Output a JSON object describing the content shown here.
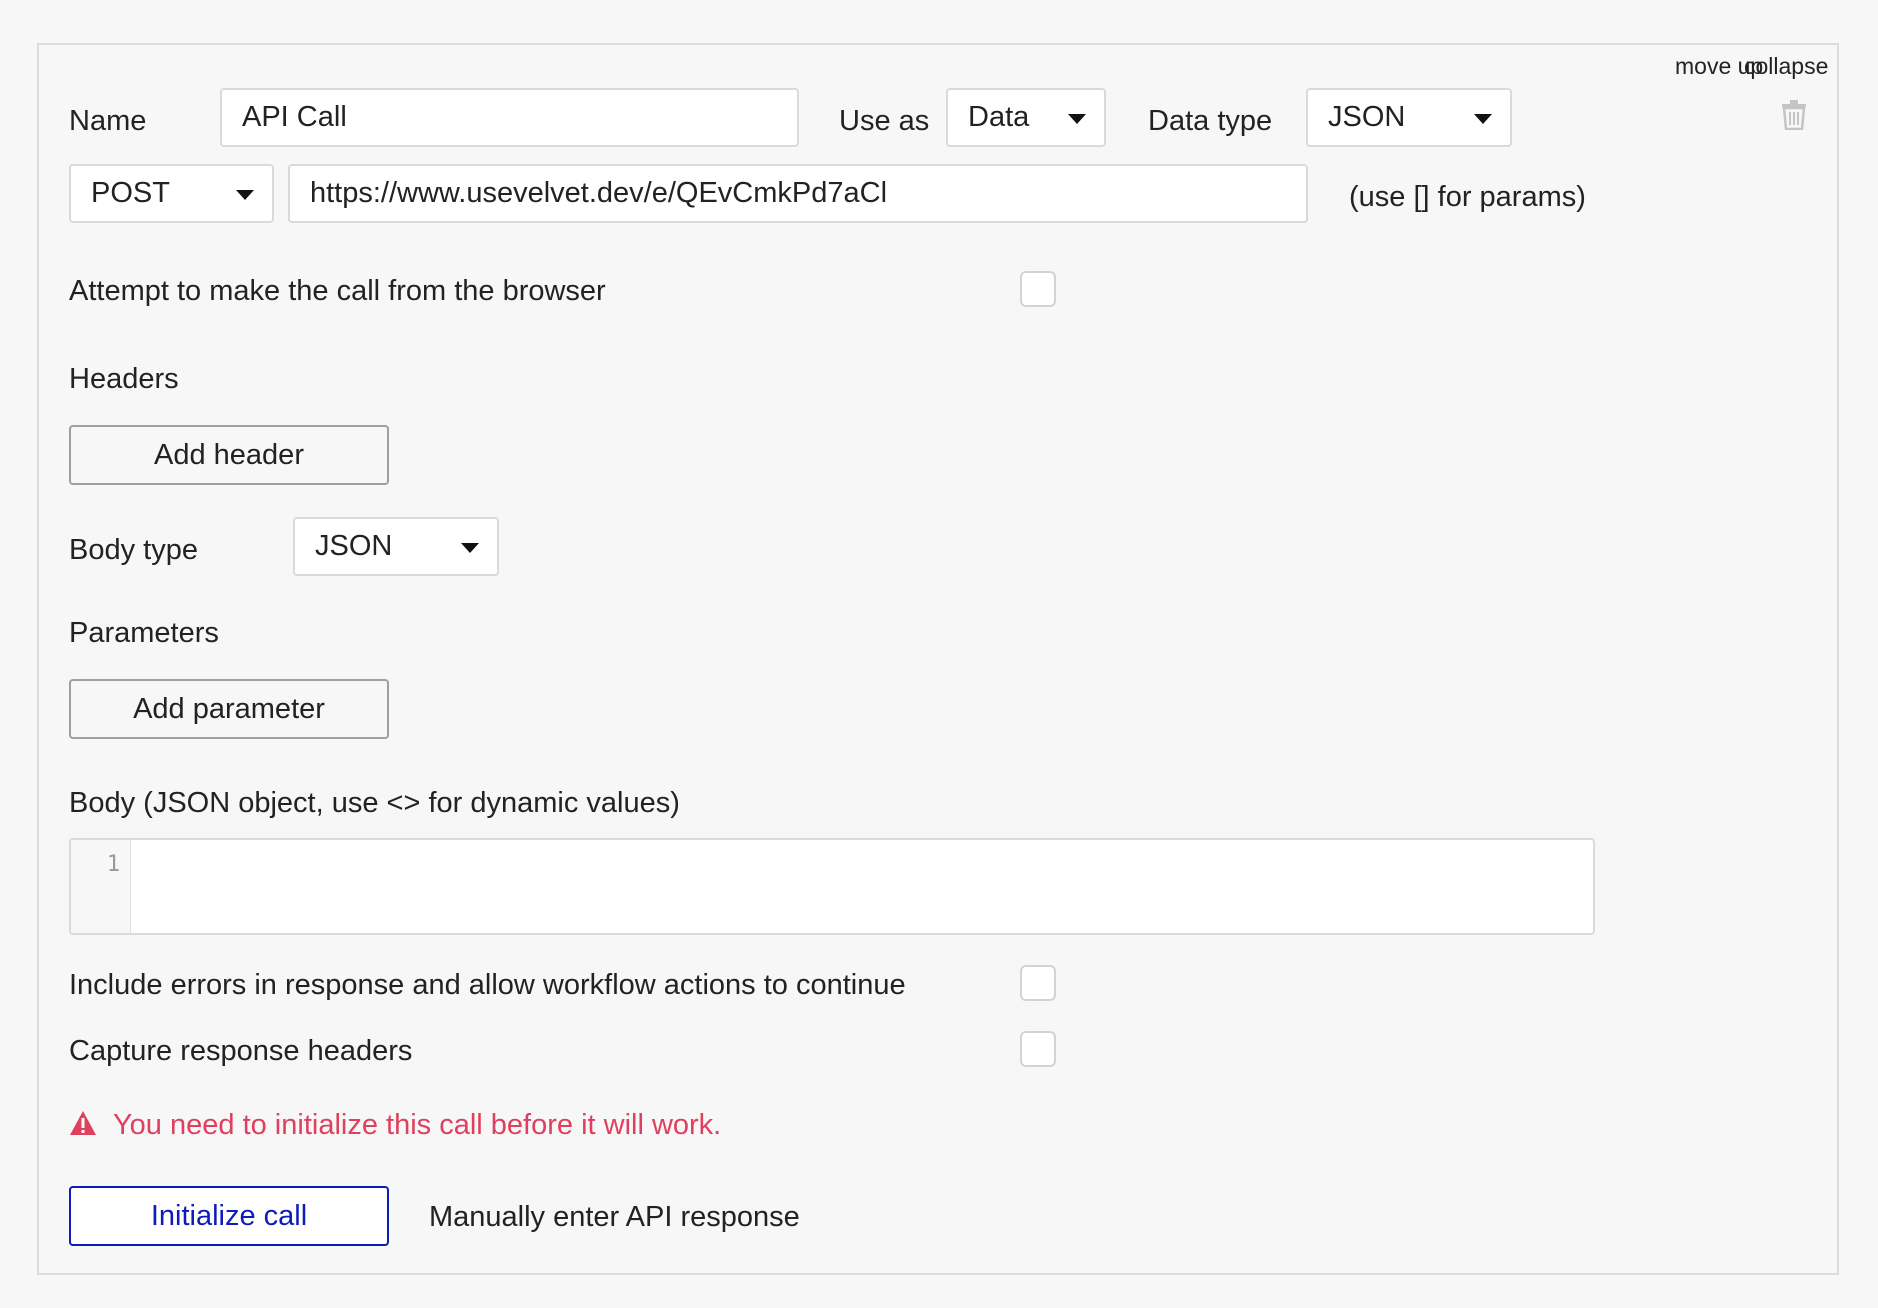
{
  "header_links": {
    "move_up": "move up",
    "collapse": "collapse"
  },
  "row1": {
    "name_label": "Name",
    "name_value": "API Call",
    "use_as_label": "Use as",
    "use_as_value": "Data",
    "data_type_label": "Data type",
    "data_type_value": "JSON"
  },
  "row2": {
    "method_value": "POST",
    "url_value": "https://www.usevelvet.dev/e/QEvCmkPd7aCl",
    "url_hint": "(use [] for params)"
  },
  "browser_call": {
    "label": "Attempt to make the call from the browser",
    "checked": false
  },
  "headers": {
    "label": "Headers",
    "add_button": "Add header"
  },
  "body_type": {
    "label": "Body type",
    "value": "JSON"
  },
  "parameters": {
    "label": "Parameters",
    "add_button": "Add parameter"
  },
  "body": {
    "label": "Body (JSON object, use <> for dynamic values)",
    "line_number": "1",
    "content": ""
  },
  "include_errors": {
    "label": "Include errors in response and allow workflow actions to continue",
    "checked": false
  },
  "capture_headers": {
    "label": "Capture response headers",
    "checked": false
  },
  "warning": {
    "text": "You need to initialize this call before it will work.",
    "icon": "warning-icon"
  },
  "actions": {
    "initialize": "Initialize call",
    "manual": "Manually enter API response"
  },
  "colors": {
    "accent": "#0d1cb8",
    "warning": "#e0405e",
    "background": "#f7f7f7"
  }
}
